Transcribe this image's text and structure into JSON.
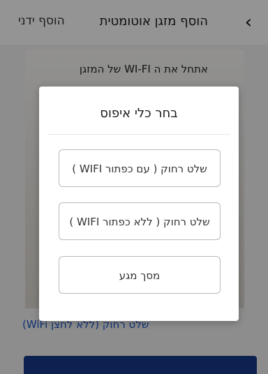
{
  "header": {
    "back_icon": "chevron-right-icon",
    "title": "הוסף מזגן אוטומטית",
    "manual_label": "הוסף ידני"
  },
  "background": {
    "instruction_title": "אתחל את ה WI-FI של המזגן",
    "remote_no_button_link": "שלט רחוק (ללא לחצן WiFi)",
    "primary_button_label": ""
  },
  "modal": {
    "title": "בחר כלי איפוס",
    "options": [
      {
        "label": "שלט רחוק ( עם כפתור WIFI )"
      },
      {
        "label": "שלט רחוק ( ללא כפתור WIFI )"
      },
      {
        "label": "מסך מגע"
      }
    ]
  },
  "colors": {
    "overlay": "#000000",
    "link": "#1a56c8",
    "primary_button": "#173a8a"
  }
}
